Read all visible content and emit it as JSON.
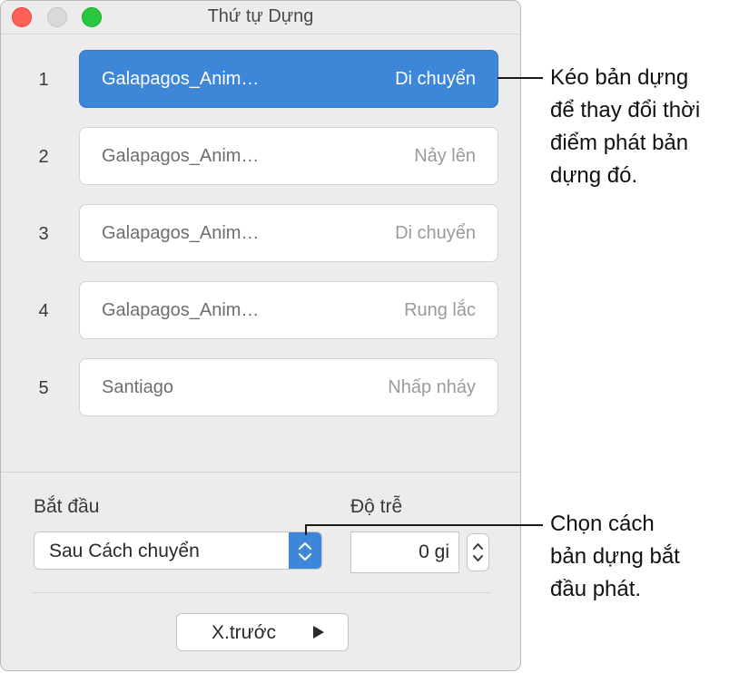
{
  "window": {
    "title": "Thứ tự Dựng"
  },
  "builds": [
    {
      "number": "1",
      "name": "Galapagos_Anim…",
      "effect": "Di chuyển",
      "selected": true
    },
    {
      "number": "2",
      "name": "Galapagos_Anim…",
      "effect": "Nảy lên",
      "selected": false
    },
    {
      "number": "3",
      "name": "Galapagos_Anim…",
      "effect": "Di chuyển",
      "selected": false
    },
    {
      "number": "4",
      "name": "Galapagos_Anim…",
      "effect": "Rung lắc",
      "selected": false
    },
    {
      "number": "5",
      "name": "Santiago",
      "effect": "Nhấp nháy",
      "selected": false
    }
  ],
  "start": {
    "label": "Bắt đầu",
    "value": "Sau Cách chuyển"
  },
  "delay": {
    "label": "Độ trễ",
    "value": "0 gi"
  },
  "preview": {
    "label": "X.trước"
  },
  "callouts": {
    "drag_build": "Kéo bản dựng\nđể thay đổi thời\nđiểm phát bản\ndựng đó.",
    "choose_start": "Chọn cách\nbản dựng bắt\nđầu phát."
  },
  "colors": {
    "accent": "#3e86d8",
    "close": "#fe5f57",
    "maximize": "#28c840"
  }
}
